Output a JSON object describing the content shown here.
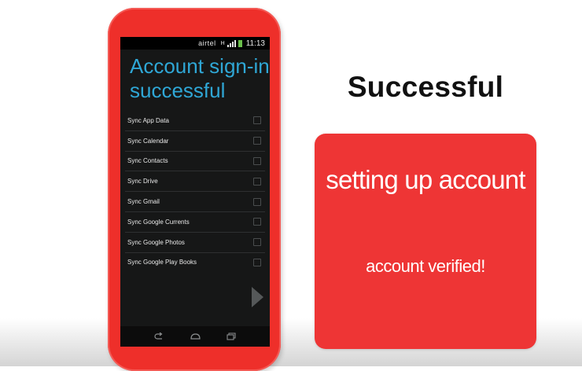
{
  "phone": {
    "status_bar": {
      "carrier": "airtel",
      "network": "H",
      "time": "11:13"
    },
    "heading_line1": "Account sign-in",
    "heading_line2": "successful",
    "sync_items": [
      {
        "label": "Sync App Data",
        "checked": false
      },
      {
        "label": "Sync Calendar",
        "checked": false
      },
      {
        "label": "Sync Contacts",
        "checked": false
      },
      {
        "label": "Sync Drive",
        "checked": false
      },
      {
        "label": "Sync Gmail",
        "checked": false
      },
      {
        "label": "Sync Google Currents",
        "checked": false
      },
      {
        "label": "Sync Google Photos",
        "checked": false
      },
      {
        "label": "Sync Google Play Books",
        "checked": false
      }
    ],
    "icons": {
      "next": "play-arrow-icon",
      "back": "back-icon",
      "home": "home-icon",
      "recents": "recents-icon"
    }
  },
  "success_title": "Successful",
  "card": {
    "title": "setting up account",
    "status": "account verified!"
  },
  "colors": {
    "phone_body": "#ee2f2a",
    "card": "#ee3535",
    "heading_blue": "#2fa7d6",
    "screen": "#161717"
  }
}
